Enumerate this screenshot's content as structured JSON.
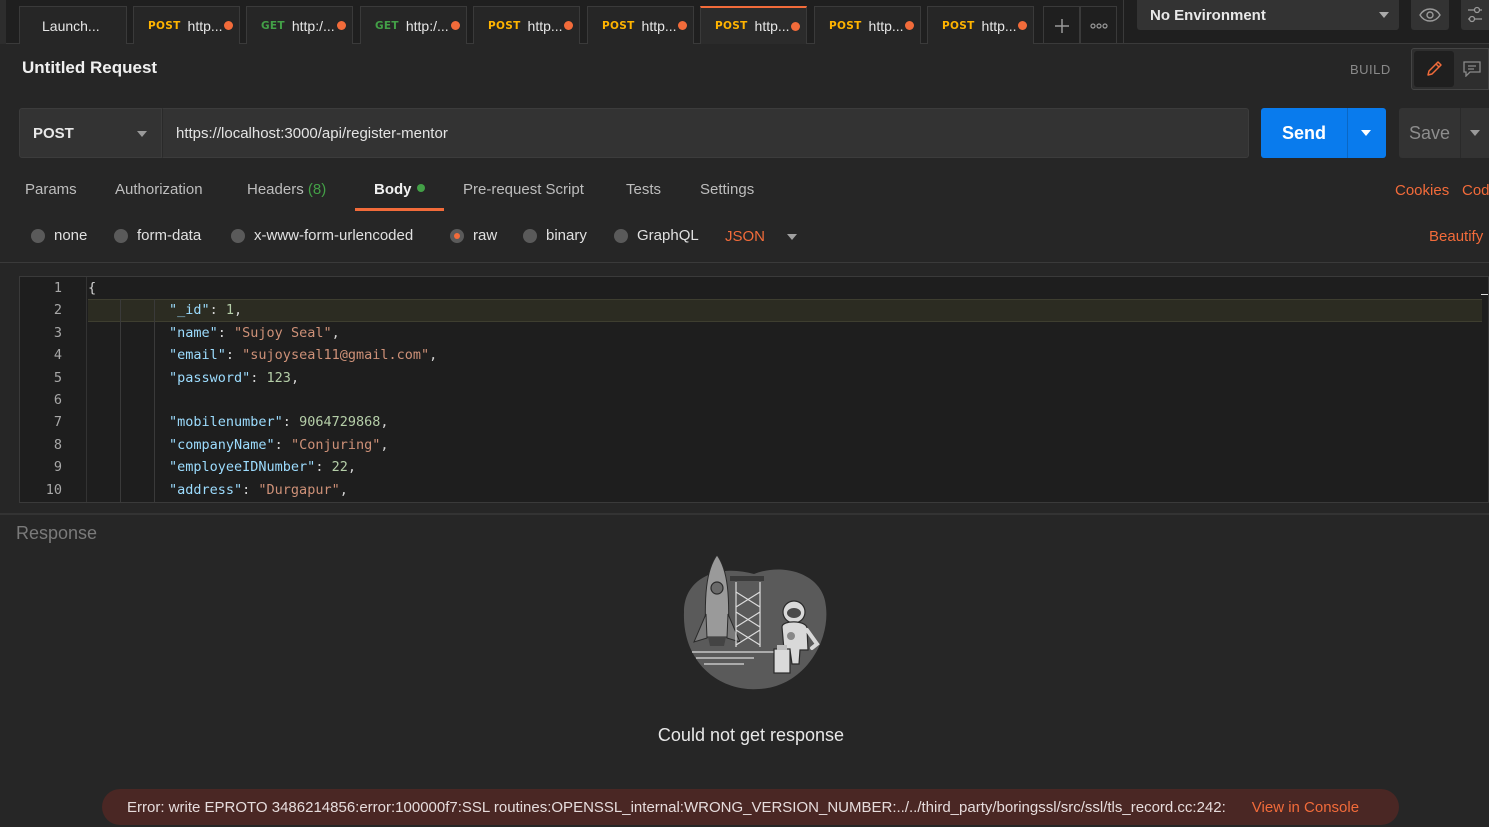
{
  "tabs": [
    {
      "method": "",
      "label": "Launch..."
    },
    {
      "method": "POST",
      "label": "http..."
    },
    {
      "method": "GET",
      "label": "http:/..."
    },
    {
      "method": "GET",
      "label": "http:/..."
    },
    {
      "method": "POST",
      "label": "http..."
    },
    {
      "method": "POST",
      "label": "http..."
    },
    {
      "method": "POST",
      "label": "http..."
    },
    {
      "method": "POST",
      "label": "http..."
    },
    {
      "method": "POST",
      "label": "http..."
    }
  ],
  "environment": {
    "selected": "No Environment"
  },
  "request": {
    "title": "Untitled Request",
    "mode_label": "BUILD",
    "method": "POST",
    "url": "https://localhost:3000/api/register-mentor",
    "send_label": "Send",
    "save_label": "Save"
  },
  "request_tabs": {
    "params": "Params",
    "authorization": "Authorization",
    "headers": "Headers",
    "headers_count": "(8)",
    "body": "Body",
    "prerequest": "Pre-request Script",
    "tests": "Tests",
    "settings": "Settings",
    "cookies": "Cookies",
    "code": "Cod"
  },
  "body_options": {
    "none": "none",
    "form_data": "form-data",
    "urlencoded": "x-www-form-urlencoded",
    "raw": "raw",
    "binary": "binary",
    "graphql": "GraphQL",
    "format": "JSON",
    "beautify": "Beautify"
  },
  "editor": {
    "line_numbers": [
      "1",
      "2",
      "3",
      "4",
      "5",
      "6",
      "7",
      "8",
      "9",
      "10"
    ],
    "lines": [
      [
        {
          "t": "{",
          "c": "p"
        }
      ],
      [
        {
          "t": "\"_id\"",
          "c": "k"
        },
        {
          "t": ": ",
          "c": "p"
        },
        {
          "t": "1",
          "c": "n"
        },
        {
          "t": ",",
          "c": "p"
        }
      ],
      [
        {
          "t": "\"name\"",
          "c": "k"
        },
        {
          "t": ": ",
          "c": "p"
        },
        {
          "t": "\"Sujoy Seal\"",
          "c": "s"
        },
        {
          "t": ",",
          "c": "p"
        }
      ],
      [
        {
          "t": "\"email\"",
          "c": "k"
        },
        {
          "t": ": ",
          "c": "p"
        },
        {
          "t": "\"sujoyseal11@gmail.com\"",
          "c": "s"
        },
        {
          "t": ",",
          "c": "p"
        }
      ],
      [
        {
          "t": "\"password\"",
          "c": "k"
        },
        {
          "t": ": ",
          "c": "p"
        },
        {
          "t": "123",
          "c": "n"
        },
        {
          "t": ",",
          "c": "p"
        }
      ],
      [],
      [
        {
          "t": "\"mobilenumber\"",
          "c": "k"
        },
        {
          "t": ": ",
          "c": "p"
        },
        {
          "t": "9064729868",
          "c": "n"
        },
        {
          "t": ",",
          "c": "p"
        }
      ],
      [
        {
          "t": "\"companyName\"",
          "c": "k"
        },
        {
          "t": ": ",
          "c": "p"
        },
        {
          "t": "\"Conjuring\"",
          "c": "s"
        },
        {
          "t": ",",
          "c": "p"
        }
      ],
      [
        {
          "t": "\"employeeIDNumber\"",
          "c": "k"
        },
        {
          "t": ": ",
          "c": "p"
        },
        {
          "t": "22",
          "c": "n"
        },
        {
          "t": ",",
          "c": "p"
        }
      ],
      [
        {
          "t": "\"address\"",
          "c": "k"
        },
        {
          "t": ": ",
          "c": "p"
        },
        {
          "t": "\"Durgapur\"",
          "c": "s"
        },
        {
          "t": ",",
          "c": "p"
        }
      ]
    ]
  },
  "response": {
    "title": "Response",
    "empty_message": "Could not get response",
    "error": "Error: write EPROTO 3486214856:error:100000f7:SSL routines:OPENSSL_internal:WRONG_VERSION_NUMBER:../../third_party/boringssl/src/ssl/tls_record.cc:242:",
    "console_link": "View in Console"
  },
  "colors": {
    "accent": "#f26b3a",
    "send": "#097bed",
    "post": "#ffb400",
    "get": "#43a047",
    "error_bg": "#4a2724"
  },
  "icons": [
    "plus-icon",
    "more-icon",
    "eye-icon",
    "sliders-icon",
    "pencil-icon",
    "comment-icon",
    "rocket-illustration"
  ]
}
